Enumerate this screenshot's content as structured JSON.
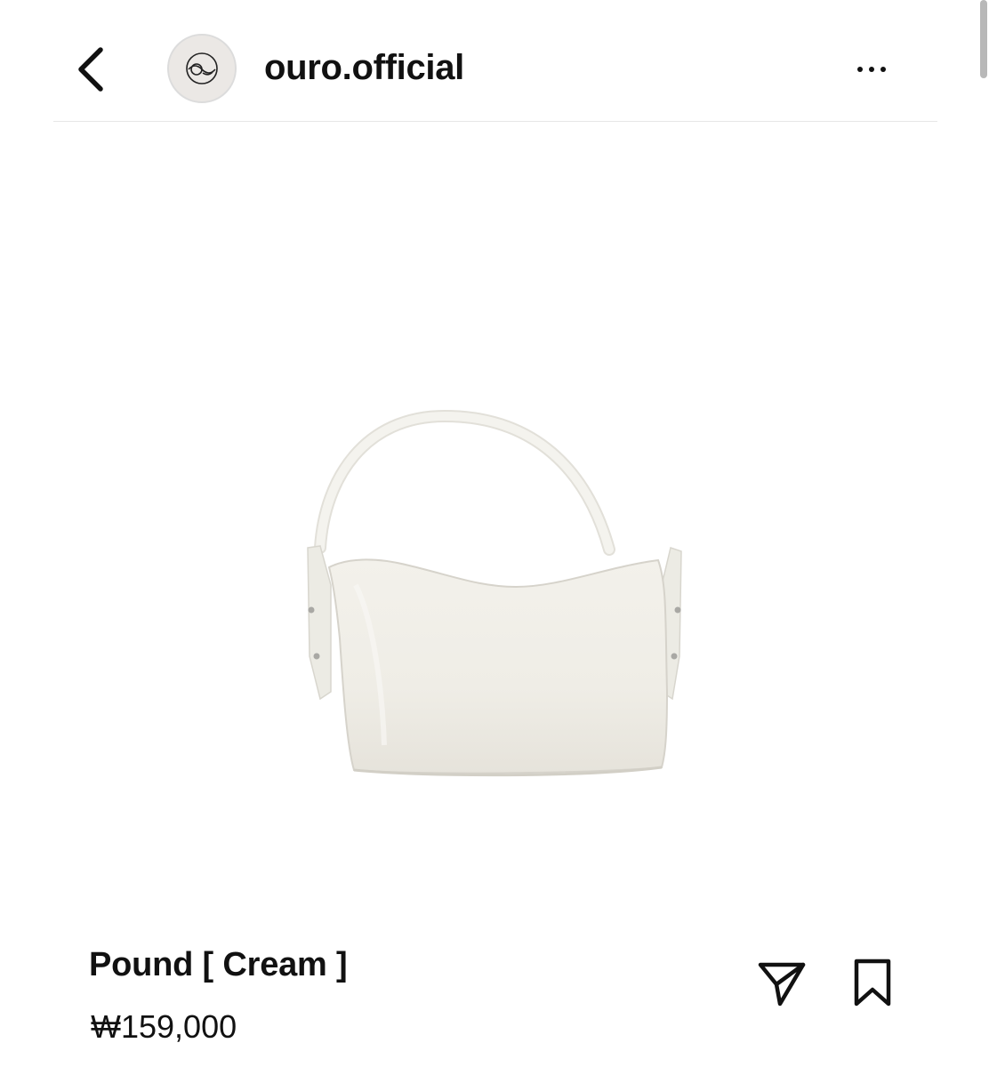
{
  "header": {
    "username": "ouro.official",
    "icons": {
      "back": "chevron-left-icon",
      "avatar": "brand-logo",
      "more": "more-horizontal-icon"
    }
  },
  "product": {
    "title": "Pound [ Cream ]",
    "price": "₩159,000",
    "image": "cream-shoulder-bag",
    "bag_color": "#f1efe9"
  },
  "actions": {
    "icons": {
      "share": "send-icon",
      "save": "bookmark-icon"
    }
  }
}
